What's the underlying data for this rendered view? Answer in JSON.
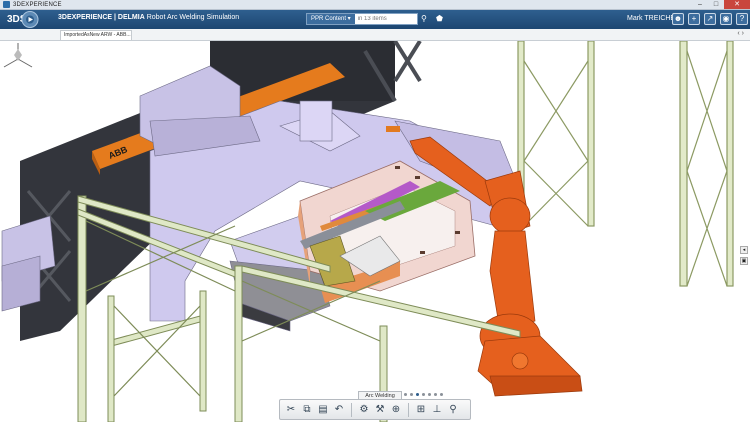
{
  "window": {
    "title": "3DEXPERIENCE",
    "minimize": "–",
    "maximize": "□",
    "close": "✕"
  },
  "header": {
    "logo": "3DS",
    "brand_bold": "3DEXPERIENCE | DELMIA",
    "brand_app": "Robot Arc Welding Simulation",
    "search_scope": "PPR Content ▾",
    "search_placeholder": "in 13 items",
    "search_icon": "search-icon",
    "tag_icon": "tag-icon",
    "user_name": "Mark TREICHEL",
    "icons": [
      "user-icon",
      "add-icon",
      "share-icon",
      "community-icon",
      "help-icon"
    ]
  },
  "tabs": [
    {
      "label": "ImportedAsNew ARW - ABB..."
    }
  ],
  "tab_nav": "‹ ›",
  "actionbar": {
    "label": "Arc Welding",
    "pages": 7,
    "active_page": 2,
    "buttons": [
      "cut-icon",
      "copy-icon",
      "paste-icon",
      "undo-icon",
      "robot-icon",
      "robot-program-icon",
      "inspect-icon",
      "teach-icon",
      "tag-point-icon",
      "torch-icon"
    ]
  },
  "colors": {
    "header": "#1d4671",
    "robot": "#e5601e",
    "frame": "#dfe8c6",
    "fixture_purple": "#cdc6ec",
    "panel_dark": "#2b2d33",
    "abb_orange": "#e57b1d"
  }
}
